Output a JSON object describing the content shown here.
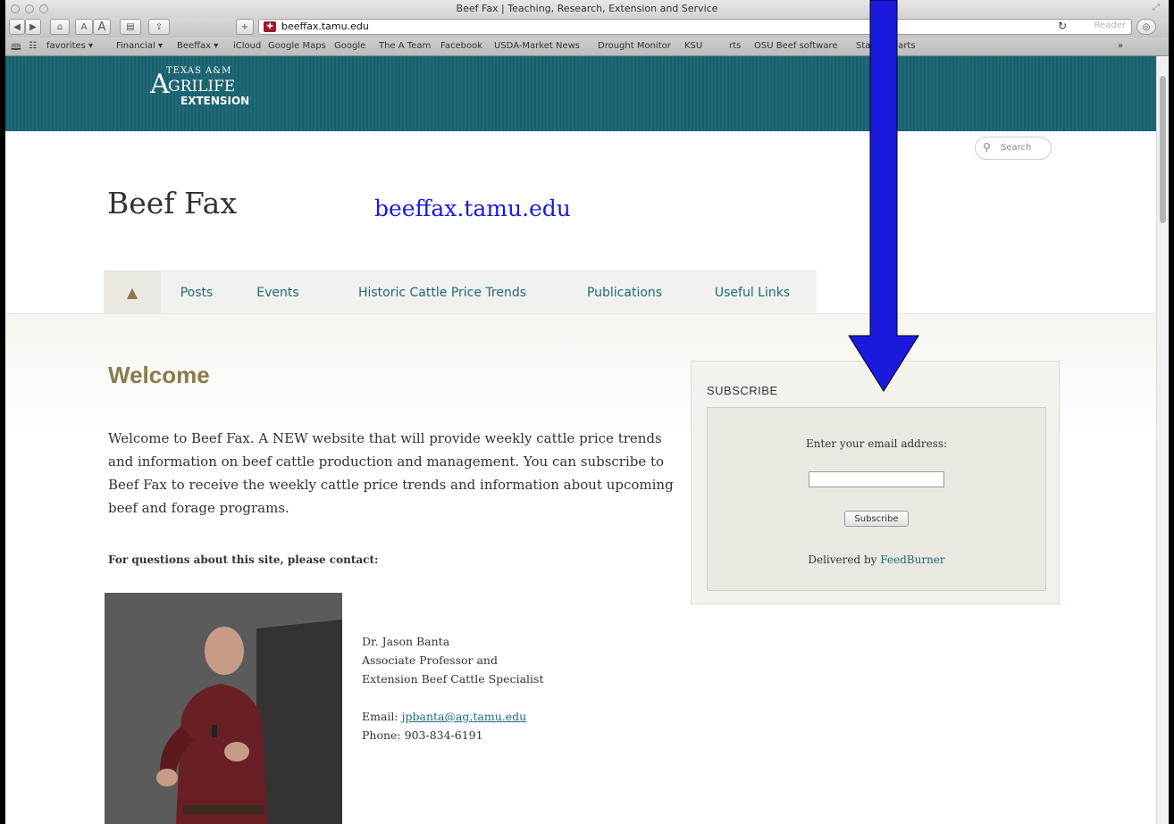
{
  "browser": {
    "window_title": "Beef Fax | Teaching, Research, Extension and Service",
    "url": "beeffax.tamu.edu",
    "reader_label": "Reader",
    "font_small_label": "A",
    "font_large_label": "A",
    "bookmarks": [
      "favorites ▾",
      "Financial ▾",
      "Beeffax ▾",
      "iCloud",
      "Google Maps",
      "Google",
      "The A Team",
      "Facebook",
      "USDA-Market News",
      "Drought Monitor",
      "KSU",
      "rts",
      "OSU Beef software",
      "Stan's Charts",
      "»"
    ]
  },
  "logo": {
    "top": "TEXAS A&M",
    "initial": "A",
    "mid": "GRILIFE",
    "bottom": "EXTENSION"
  },
  "search": {
    "placeholder": "Search"
  },
  "site_title": "Beef Fax",
  "url_overlay": "beeffax.tamu.edu",
  "nav": {
    "home_icon": "home-icon",
    "tabs": [
      "Posts",
      "Events",
      "Historic Cattle Price Trends",
      "Publications",
      "Useful Links"
    ]
  },
  "main": {
    "welcome_heading": "Welcome",
    "intro": "Welcome to Beef Fax. A NEW website that will provide weekly cattle price trends and  information on beef cattle production and management. You can subscribe to Beef Fax to receive the weekly cattle price trends and information about upcoming beef and forage programs.",
    "contact_heading": "For questions about this site, please contact:",
    "contact": {
      "name": "Dr. Jason Banta",
      "title1": "Associate Professor and",
      "title2": "Extension Beef Cattle Specialist",
      "email_label": "Email: ",
      "email": "jpbanta@ag.tamu.edu",
      "phone": "Phone: 903-834-6191"
    }
  },
  "subscribe": {
    "heading": "SUBSCRIBE",
    "label": "Enter your email address:",
    "email_value": "",
    "button": "Subscribe",
    "delivered_prefix": "Delivered by ",
    "delivered_link": "FeedBurner"
  },
  "colors": {
    "header_band": "#1f6a78",
    "accent_link": "#1f6a78",
    "welcome": "#8a7a4e",
    "arrow": "#1a1adf",
    "url_overlay": "#1a1adf"
  }
}
